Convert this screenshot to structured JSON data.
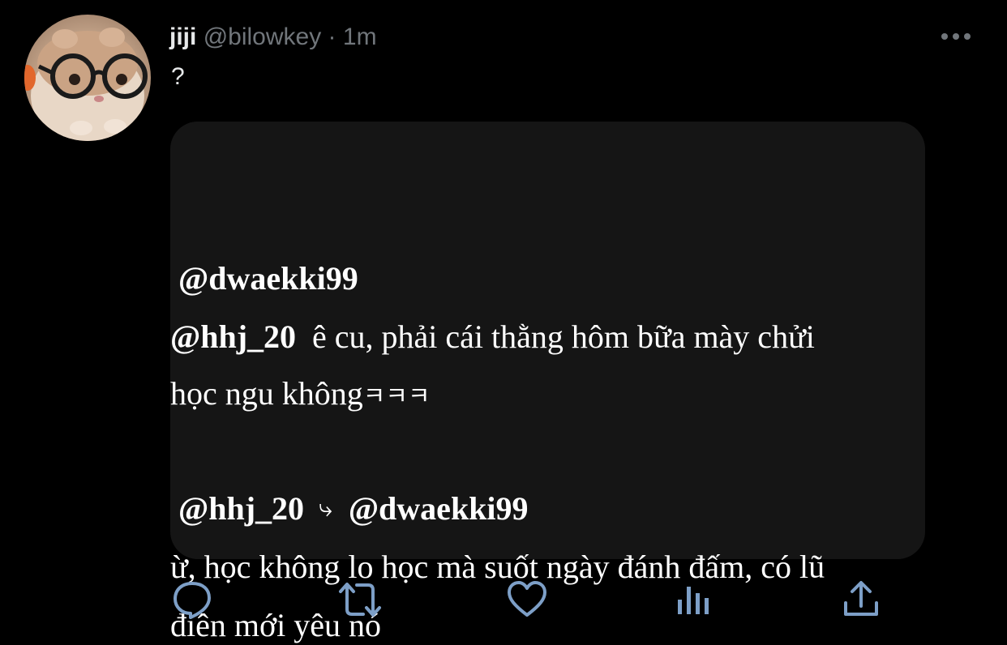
{
  "tweet": {
    "display_name": "jiji",
    "handle": "@bilowkey",
    "separator": "·",
    "time": "1m",
    "text": "?"
  },
  "quote": {
    "author1": "@dwaekki99",
    "mention1": "@hhj_20",
    "msg1_line1": "ê cu, phải cái thằng hôm bữa mày chửi",
    "msg1_line2": "học ngu không",
    "msg1_laugh": "ㅋㅋㅋ",
    "author2": "@hhj_20",
    "reply_arrow": "⤷",
    "reply_to": "@dwaekki99",
    "msg2_line1": "ừ, học không lo học mà suốt ngày đánh đấm, có lũ",
    "msg2_line2": "điên mới yêu nó"
  },
  "icons": {
    "more": "more-horizontal-icon",
    "reply": "comment-bubble-icon",
    "retweet": "retweet-icon",
    "like": "heart-icon",
    "analytics": "bar-chart-icon",
    "share": "share-upload-icon"
  },
  "colors": {
    "background": "#000000",
    "card": "#151515",
    "muted": "#71767b",
    "icon": "#7d9fc7"
  }
}
